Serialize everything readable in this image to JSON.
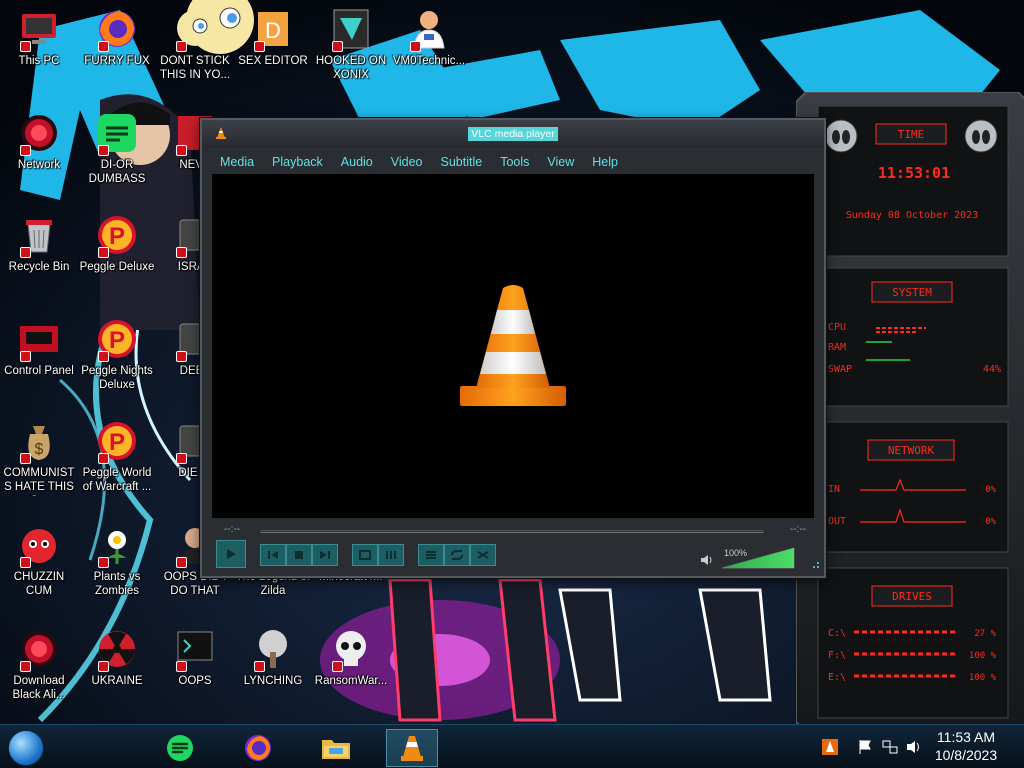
{
  "desktop": {
    "icons": [
      {
        "label": "This PC",
        "icon": "computer-icon"
      },
      {
        "label": "FURRY FUX",
        "icon": "firefox-icon"
      },
      {
        "label": "DONT STICK THIS IN YO...",
        "icon": "cartoon-character-icon"
      },
      {
        "label": "SEX EDITOR",
        "icon": "editor-icon"
      },
      {
        "label": "HOOKED ON XONIX",
        "icon": "game-icon"
      },
      {
        "label": "VM0Technic...",
        "icon": "doctor-icon"
      },
      {
        "label": "Network",
        "icon": "alienware-orb-icon"
      },
      {
        "label": "DI-OR DUMBASS",
        "icon": "green-app-icon"
      },
      {
        "label": "NEVE",
        "icon": "red-app-icon"
      },
      {
        "label": "Recycle Bin",
        "icon": "recycle-bin-icon"
      },
      {
        "label": "Peggle Deluxe",
        "icon": "peggle-icon"
      },
      {
        "label": "ISRAE",
        "icon": "app-icon"
      },
      {
        "label": "Control Panel",
        "icon": "control-panel-icon"
      },
      {
        "label": "Peggle Nights Deluxe",
        "icon": "peggle-icon"
      },
      {
        "label": "DEEZ",
        "icon": "app-icon"
      },
      {
        "label": "COMMUNISTS HATE THIS G...",
        "icon": "money-bag-icon"
      },
      {
        "label": "Peggle World of Warcraft ...",
        "icon": "peggle-icon"
      },
      {
        "label": "DIE PI",
        "icon": "app-icon"
      },
      {
        "label": "CHUZZIN CUM",
        "icon": "chuzzle-icon"
      },
      {
        "label": "Plants vs Zombies",
        "icon": "plant-icon"
      },
      {
        "label": "OOPS DID I DO THAT",
        "icon": "person-icon"
      },
      {
        "label": "The Legend of Zilda",
        "icon": "app-icon"
      },
      {
        "label": "Minecraft4...",
        "icon": "app-icon"
      },
      {
        "label": "Download Black Ali...",
        "icon": "alienware-orb-icon"
      },
      {
        "label": "UKRAINE",
        "icon": "radiation-icon"
      },
      {
        "label": "OOPS",
        "icon": "terminal-icon"
      },
      {
        "label": "LYNCHING",
        "icon": "tree-icon"
      },
      {
        "label": "RansomWar...",
        "icon": "skull-icon"
      }
    ]
  },
  "vlc": {
    "title": "VLC media player",
    "menu": [
      "Media",
      "Playback",
      "Audio",
      "Video",
      "Subtitle",
      "Tools",
      "View",
      "Help"
    ],
    "time_elapsed": "--:--",
    "time_total": "--:--",
    "volume_label": "100%",
    "volume_level": 1.0,
    "accent": "#5ee2e6"
  },
  "gadget": {
    "time_title": "TIME",
    "time": "11:53:01",
    "date": "Sunday 08 October 2023",
    "system_title": "SYSTEM",
    "system_rows": [
      {
        "label": "CPU",
        "value": ""
      },
      {
        "label": "RAM",
        "value": ""
      },
      {
        "label": "SWAP",
        "value": "44%"
      }
    ],
    "network_title": "NETWORK",
    "network_rows": [
      {
        "label": "IN",
        "value": "0%"
      },
      {
        "label": "OUT",
        "value": "0%"
      }
    ],
    "drives_title": "DRIVES",
    "drives": [
      {
        "label": "C:\\",
        "value": "27 %"
      },
      {
        "label": "F:\\",
        "value": "100 %"
      },
      {
        "label": "E:\\",
        "value": "100 %"
      }
    ],
    "accent": "#ff2a1a"
  },
  "taskbar": {
    "apps": [
      "notes-app-icon",
      "firefox-icon",
      "file-explorer-icon",
      "vlc-icon"
    ],
    "active_app": "vlc-icon",
    "clock_time": "11:53 AM",
    "clock_date": "10/8/2023"
  }
}
